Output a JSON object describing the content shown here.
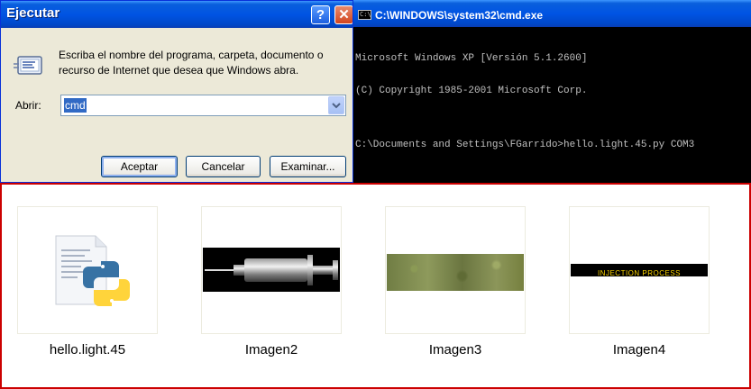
{
  "run_dialog": {
    "title": "Ejecutar",
    "help_glyph": "?",
    "close_glyph": "✕",
    "description": "Escriba el nombre del programa, carpeta, documento o recurso de Internet que desea que Windows abra.",
    "open_label": "Abrir:",
    "open_value": "cmd",
    "buttons": {
      "ok": "Aceptar",
      "cancel": "Cancelar",
      "browse": "Examinar..."
    },
    "icons": [
      "run-icon",
      "chevron-down-icon",
      "help-icon",
      "close-icon"
    ]
  },
  "cmd_window": {
    "title": "C:\\WINDOWS\\system32\\cmd.exe",
    "icon_text": "C:\\",
    "lines": [
      "Microsoft Windows XP [Versión 5.1.2600]",
      "(C) Copyright 1985-2001 Microsoft Corp.",
      "",
      "C:\\Documents and Settings\\FGarrido>hello.light.45.py COM3"
    ]
  },
  "explorer": {
    "items": [
      {
        "label": "hello.light.45",
        "icon": "python-file-icon"
      },
      {
        "label": "Imagen2",
        "icon": "syringe-image"
      },
      {
        "label": "Imagen3",
        "icon": "texture-image"
      },
      {
        "label": "Imagen4",
        "icon": "injection-banner-image",
        "image_text": "INJECTION PROCESS"
      }
    ]
  },
  "colors": {
    "xp_title_blue": "#0054e3",
    "dialog_bg": "#ece9d8",
    "selection_blue": "#316ac5",
    "console_text": "#c0c0c0",
    "explorer_border_red": "#cc0000",
    "banner_yellow": "#ffd700"
  }
}
